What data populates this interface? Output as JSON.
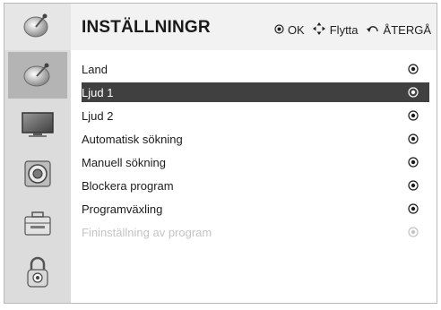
{
  "header": {
    "title": "INSTÄLLNINGR",
    "hints": [
      {
        "icon": "ok-icon",
        "label": "OK"
      },
      {
        "icon": "move-arrows-icon",
        "label": "Flytta"
      },
      {
        "icon": "return-icon",
        "label": "ÅTERGÅ"
      }
    ]
  },
  "sidebar": {
    "header_icon": "satellite-dish-icon",
    "items": [
      {
        "icon": "satellite-dish-icon",
        "active": true
      },
      {
        "icon": "tv-screen-icon",
        "active": false
      },
      {
        "icon": "speaker-icon",
        "active": false
      },
      {
        "icon": "toolbox-icon",
        "active": false
      },
      {
        "icon": "lock-icon",
        "active": false
      }
    ]
  },
  "menu": {
    "items": [
      {
        "label": "Land",
        "state": "normal"
      },
      {
        "label": "Ljud 1",
        "state": "selected"
      },
      {
        "label": "Ljud 2",
        "state": "normal"
      },
      {
        "label": "Automatisk sökning",
        "state": "normal"
      },
      {
        "label": "Manuell sökning",
        "state": "normal"
      },
      {
        "label": "Blockera program",
        "state": "normal"
      },
      {
        "label": "Programväxling",
        "state": "normal"
      },
      {
        "label": "Fininställning av program",
        "state": "disabled"
      }
    ]
  },
  "colors": {
    "selected_row": "#404040",
    "sidebar": "#dcdcdc",
    "sidebar_active": "#b4b4b4",
    "disabled_text": "#c4c4c4"
  }
}
